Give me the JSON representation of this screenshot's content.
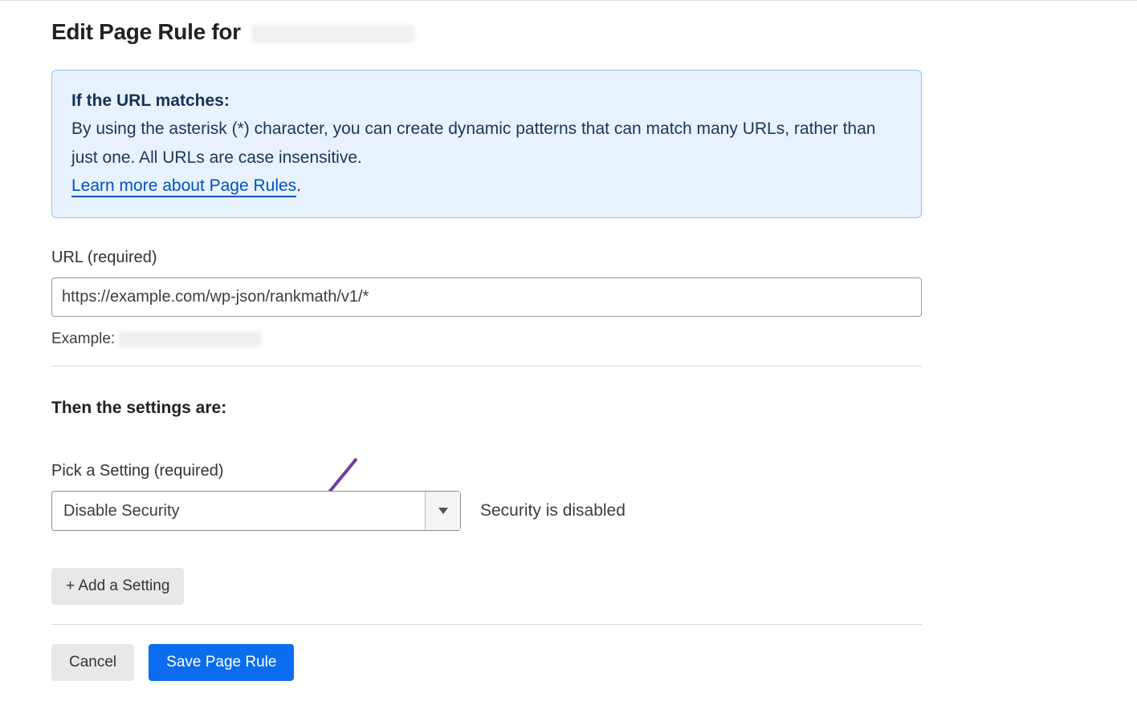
{
  "header": {
    "title_prefix": "Edit Page Rule for"
  },
  "info": {
    "lead": "If the URL matches:",
    "body": "By using the asterisk (*) character, you can create dynamic patterns that can match many URLs, rather than just one. All URLs are case insensitive.",
    "link_text": "Learn more about Page Rules",
    "link_suffix": "."
  },
  "url_field": {
    "label": "URL (required)",
    "value": "https://example.com/wp-json/rankmath/v1/*",
    "example_prefix": "Example:"
  },
  "settings": {
    "heading": "Then the settings are:",
    "pick_label": "Pick a Setting (required)",
    "selected": "Disable Security",
    "status": "Security is disabled",
    "add_button": "+ Add a Setting"
  },
  "footer": {
    "cancel": "Cancel",
    "save": "Save Page Rule"
  }
}
